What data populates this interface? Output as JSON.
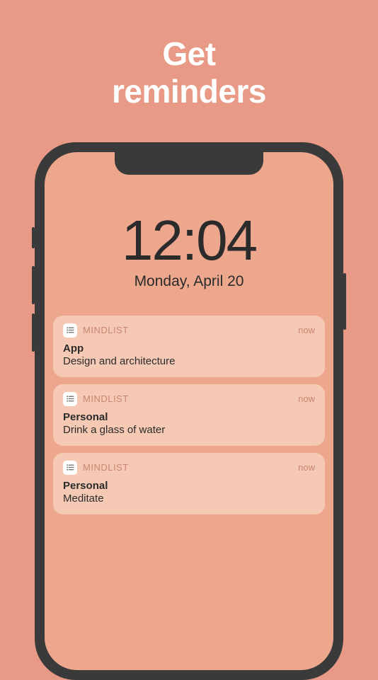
{
  "headline": {
    "line1": "Get",
    "line2": "reminders"
  },
  "lockscreen": {
    "time": "12:04",
    "date": "Monday, April 20"
  },
  "notifications": [
    {
      "app_name": "MINDLIST",
      "timestamp": "now",
      "title": "App",
      "body": "Design and architecture"
    },
    {
      "app_name": "MINDLIST",
      "timestamp": "now",
      "title": "Personal",
      "body": "Drink a glass of water"
    },
    {
      "app_name": "MINDLIST",
      "timestamp": "now",
      "title": "Personal",
      "body": "Meditate"
    }
  ]
}
